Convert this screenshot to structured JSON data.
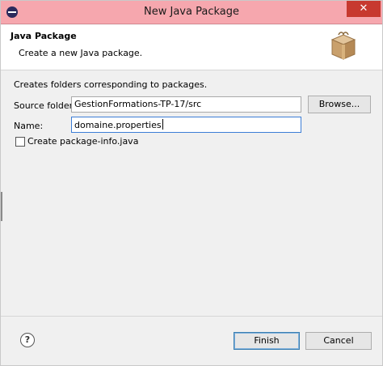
{
  "window": {
    "title": "New Java Package",
    "close_glyph": "✕"
  },
  "header": {
    "title": "Java Package",
    "description": "Create a new Java package.",
    "icon": "package-icon"
  },
  "body": {
    "description": "Creates folders corresponding to packages.",
    "source_folder": {
      "label": "Source folder:",
      "value": "GestionFormations-TP-17/src"
    },
    "browse_label": "Browse...",
    "name": {
      "label": "Name:",
      "value": "domaine.properties"
    },
    "create_package_info": {
      "label": "Create package-info.java",
      "checked": false
    }
  },
  "footer": {
    "help_glyph": "?",
    "finish_label": "Finish",
    "cancel_label": "Cancel"
  }
}
